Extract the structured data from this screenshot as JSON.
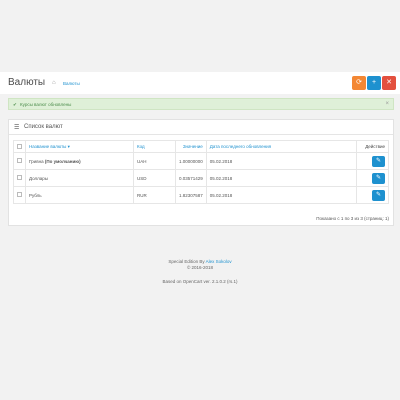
{
  "header": {
    "title": "Валюты",
    "breadcrumb": "Валюты",
    "buttons": {
      "refresh": "⟳",
      "add": "+",
      "delete": "✕"
    }
  },
  "alert": {
    "message": "Курсы валют обновлены",
    "close": "×"
  },
  "panel": {
    "title": "Список валют",
    "columns": {
      "name": "Название валюты",
      "code": "Код",
      "value": "Значение",
      "date": "Дата последнего обновления",
      "action": "Действие"
    },
    "rows": [
      {
        "name": "Гривна",
        "default": "(По умолчанию)",
        "code": "UAH",
        "value": "1.00000000",
        "date": "05.02.2018"
      },
      {
        "name": "Доллары",
        "default": "",
        "code": "USD",
        "value": "0.03571429",
        "date": "05.02.2018"
      },
      {
        "name": "Рубль",
        "default": "",
        "code": "RUR",
        "value": "1.82307587",
        "date": "05.02.2018"
      }
    ],
    "pagination": "Показано с 1 по 3 из 3 (страниц: 1)"
  },
  "footer": {
    "edition_prefix": "Special Edition By",
    "edition_author": "Alex Sokolov",
    "years": "© 2016-2018",
    "based_on": "Based on OpenCart ver. 2.1.0.2 (rs.1)"
  },
  "colors": {
    "accent": "#1e91cf",
    "refresh": "#f38733",
    "delete": "#e3503e",
    "success_bg": "#dff0d8"
  }
}
